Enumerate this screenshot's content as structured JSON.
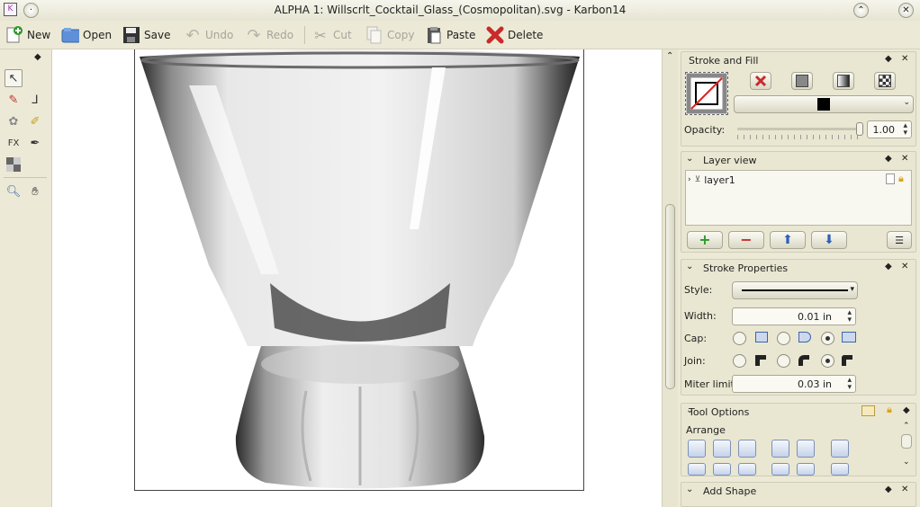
{
  "window": {
    "title": "ALPHA 1: Willscrlt_Cocktail_Glass_(Cosmopolitan).svg - Karbon14"
  },
  "toolbar": {
    "new": "New",
    "open": "Open",
    "save": "Save",
    "undo": "Undo",
    "redo": "Redo",
    "cut": "Cut",
    "copy": "Copy",
    "paste": "Paste",
    "delete": "Delete"
  },
  "stroke_fill": {
    "title": "Stroke and Fill",
    "opacity_label": "Opacity:",
    "opacity_value": "1.00"
  },
  "layer_view": {
    "title": "Layer view",
    "layers": [
      "layer1"
    ]
  },
  "stroke_props": {
    "title": "Stroke Properties",
    "style_label": "Style:",
    "width_label": "Width:",
    "width_value": "0.01 in",
    "cap_label": "Cap:",
    "join_label": "Join:",
    "miter_label": "Miter limit:",
    "miter_value": "0.03 in"
  },
  "tool_options": {
    "title": "Tool Options",
    "arrange_label": "Arrange"
  },
  "add_shape": {
    "title": "Add Shape"
  },
  "colors": {
    "accent": "#cc2b2b",
    "panel": "#e9e7d1",
    "toolbar": "#ecead6"
  }
}
